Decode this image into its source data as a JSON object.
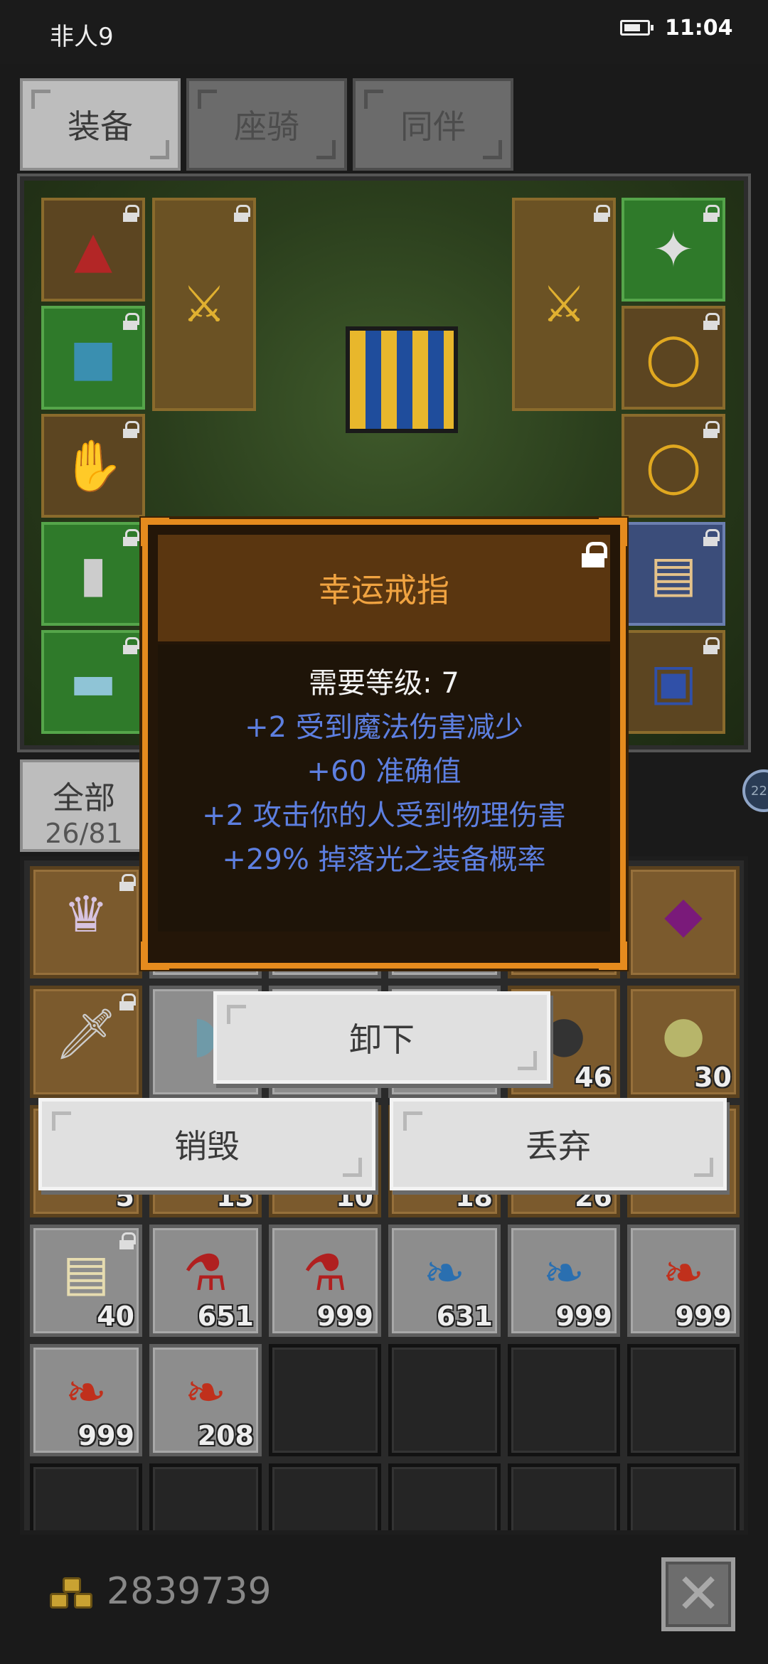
{
  "status_bar": {
    "carrier": "非人9",
    "time": "11:04"
  },
  "tabs": [
    {
      "label": "装备",
      "active": true
    },
    {
      "label": "座骑",
      "active": false
    },
    {
      "label": "同伴",
      "active": false
    }
  ],
  "equipment": {
    "left_slots": [
      "hat-icon",
      "armor-icon",
      "glove-icon",
      "boots-icon",
      "belt-icon"
    ],
    "weapon_slots": [
      "sword-icon",
      "sword-icon"
    ],
    "right_slots": [
      "amulet-icon",
      "ring-icon",
      "ring-icon",
      "scroll-icon",
      "chest-icon"
    ]
  },
  "inventory": {
    "filter_label": "全部",
    "count": "26/81",
    "rows": [
      [
        {
          "icon": "portrait-icon",
          "qty": ""
        },
        {
          "icon": "",
          "qty": ""
        },
        {
          "icon": "",
          "qty": ""
        },
        {
          "icon": "",
          "qty": ""
        },
        {
          "icon": "",
          "qty": ""
        },
        {
          "icon": "gem-icon",
          "qty": ""
        }
      ],
      [
        {
          "icon": "sword-icon",
          "qty": ""
        },
        {
          "icon": "fish-icon",
          "qty": ""
        },
        {
          "icon": "",
          "qty": ""
        },
        {
          "icon": "",
          "qty": ""
        },
        {
          "icon": "ore-icon",
          "qty": "46"
        },
        {
          "icon": "bag-icon",
          "qty": "30"
        }
      ],
      [
        {
          "icon": "",
          "qty": "5"
        },
        {
          "icon": "",
          "qty": "13"
        },
        {
          "icon": "",
          "qty": "10"
        },
        {
          "icon": "",
          "qty": "18"
        },
        {
          "icon": "",
          "qty": "26"
        },
        {
          "icon": "",
          "qty": ""
        }
      ],
      [
        {
          "icon": "scroll-icon",
          "qty": "40"
        },
        {
          "icon": "potion-icon",
          "qty": "651"
        },
        {
          "icon": "potion-icon",
          "qty": "999"
        },
        {
          "icon": "blue-feather-icon",
          "qty": "631"
        },
        {
          "icon": "blue-feather-icon",
          "qty": "999"
        },
        {
          "icon": "red-feather-icon",
          "qty": "999"
        }
      ],
      [
        {
          "icon": "red-feather-icon",
          "qty": "999"
        },
        {
          "icon": "red-feather-icon",
          "qty": "208"
        }
      ]
    ]
  },
  "tooltip": {
    "title": "幸运戒指",
    "requirement": "需要等级: 7",
    "stats": [
      "+2 受到魔法伤害减少",
      "+60 准确值",
      "+2 攻击你的人受到物理伤害",
      "+29% 掉落光之装备概率"
    ]
  },
  "actions": {
    "unequip": "卸下",
    "destroy": "销毁",
    "discard": "丢弃"
  },
  "gold": "2839739",
  "side_badge": "22",
  "colors": {
    "tooltip_border": "#e58b1e",
    "tooltip_title": "#f0a341",
    "stat_text": "#5d7fe0"
  }
}
